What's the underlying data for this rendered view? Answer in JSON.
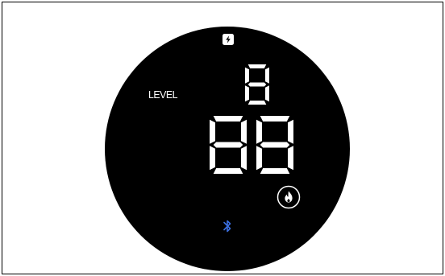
{
  "display": {
    "level_label": "LEVEL",
    "level_value": "8",
    "main_value": "88"
  },
  "icons": {
    "mode": "bolt-icon",
    "heat": "flame-icon",
    "connectivity": "bluetooth-icon"
  },
  "colors": {
    "dial": "#000000",
    "segment": "#ffffff",
    "bluetooth": "#3b6fe0"
  }
}
